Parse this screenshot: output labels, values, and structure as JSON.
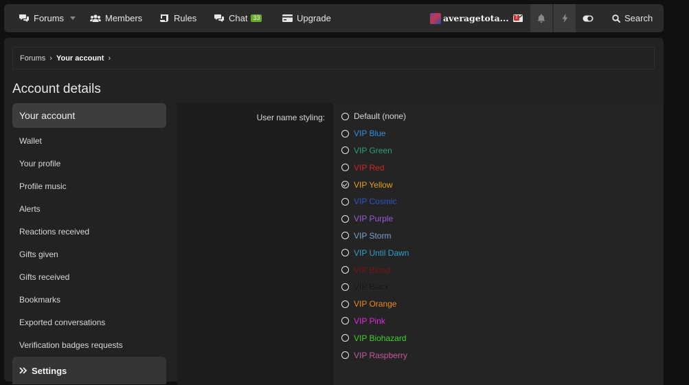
{
  "nav": {
    "forums": "Forums",
    "members": "Members",
    "rules": "Rules",
    "chat": "Chat",
    "chat_badge": "33",
    "upgrade": "Upgrade",
    "username": "averagetota...",
    "search": "Search",
    "inbox_badge": "1"
  },
  "breadcrumb": {
    "root": "Forums",
    "current": "Your account"
  },
  "page_title": "Account details",
  "sidebar": {
    "items": [
      {
        "label": "Your account"
      },
      {
        "label": "Wallet"
      },
      {
        "label": "Your profile"
      },
      {
        "label": "Profile music"
      },
      {
        "label": "Alerts"
      },
      {
        "label": "Reactions received"
      },
      {
        "label": "Gifts given"
      },
      {
        "label": "Gifts received"
      },
      {
        "label": "Bookmarks"
      },
      {
        "label": "Exported conversations"
      },
      {
        "label": "Verification badges requests"
      }
    ],
    "settings_label": "Settings"
  },
  "form": {
    "field_label": "User name styling:",
    "options": [
      {
        "label": "Default (none)",
        "color": "#d8d8d8",
        "checked": false
      },
      {
        "label": "VIP Blue",
        "color": "#2f8ee0",
        "checked": false
      },
      {
        "label": "VIP Green",
        "color": "#26a37a",
        "checked": false
      },
      {
        "label": "VIP Red",
        "color": "#d42424",
        "checked": false
      },
      {
        "label": "VIP Yellow",
        "color": "#e0a21a",
        "checked": true
      },
      {
        "label": "VIP Cosmic",
        "color": "#2f52c8",
        "checked": false
      },
      {
        "label": "VIP Purple",
        "color": "#9b5be0",
        "checked": false
      },
      {
        "label": "VIP Storm",
        "color": "#7fa0c8",
        "checked": false
      },
      {
        "label": "VIP Until Dawn",
        "color": "#2da0c8",
        "checked": false
      },
      {
        "label": "VIP Blood",
        "color": "#7a1414",
        "checked": false
      },
      {
        "label": "VIP Black",
        "color": "#0a0a0a",
        "checked": false
      },
      {
        "label": "VIP Orange",
        "color": "#f08a1a",
        "checked": false
      },
      {
        "label": "VIP Pink",
        "color": "#e02ae0",
        "checked": false
      },
      {
        "label": "VIP Biohazard",
        "color": "#3ad42a",
        "checked": false
      },
      {
        "label": "VIP Raspberry",
        "color": "#c85a9a",
        "checked": false
      }
    ]
  }
}
